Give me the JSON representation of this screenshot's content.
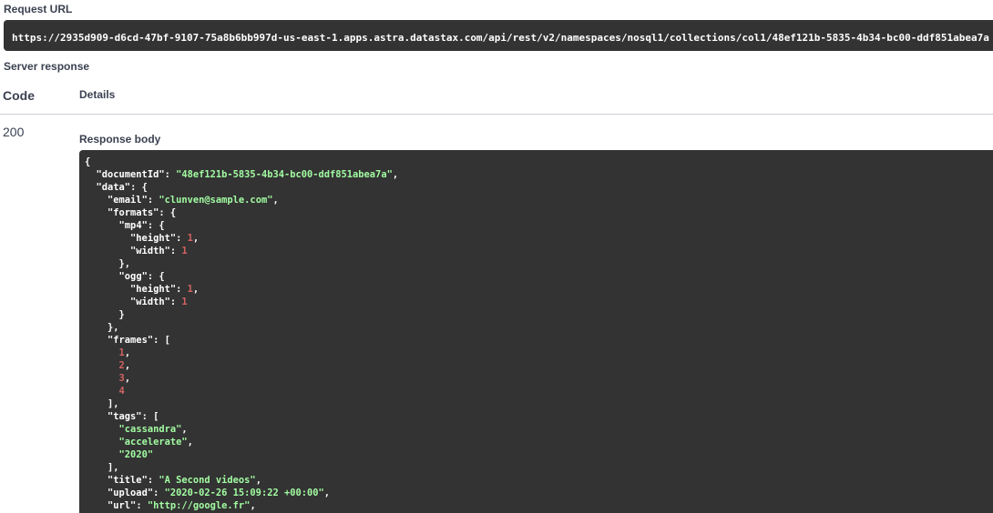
{
  "request_url": {
    "label": "Request URL",
    "value": "https://2935d909-d6cd-47bf-9107-75a8b6bb997d-us-east-1.apps.astra.datastax.com/api/rest/v2/namespaces/nosql1/collections/col1/48ef121b-5835-4b34-bc00-ddf851abea7a"
  },
  "server_response": {
    "label": "Server response",
    "columns": {
      "code": "Code",
      "details": "Details"
    },
    "status_code": "200",
    "body_label": "Response body",
    "body_lines": [
      [
        [
          "p",
          "{"
        ]
      ],
      [
        [
          "p",
          "  "
        ],
        [
          "k",
          "\"documentId\""
        ],
        [
          "p",
          ": "
        ],
        [
          "s",
          "\"48ef121b-5835-4b34-bc00-ddf851abea7a\""
        ],
        [
          "p",
          ","
        ]
      ],
      [
        [
          "p",
          "  "
        ],
        [
          "k",
          "\"data\""
        ],
        [
          "p",
          ": {"
        ]
      ],
      [
        [
          "p",
          "    "
        ],
        [
          "k",
          "\"email\""
        ],
        [
          "p",
          ": "
        ],
        [
          "s",
          "\"clunven@sample.com\""
        ],
        [
          "p",
          ","
        ]
      ],
      [
        [
          "p",
          "    "
        ],
        [
          "k",
          "\"formats\""
        ],
        [
          "p",
          ": {"
        ]
      ],
      [
        [
          "p",
          "      "
        ],
        [
          "k",
          "\"mp4\""
        ],
        [
          "p",
          ": {"
        ]
      ],
      [
        [
          "p",
          "        "
        ],
        [
          "k",
          "\"height\""
        ],
        [
          "p",
          ": "
        ],
        [
          "n",
          "1"
        ],
        [
          "p",
          ","
        ]
      ],
      [
        [
          "p",
          "        "
        ],
        [
          "k",
          "\"width\""
        ],
        [
          "p",
          ": "
        ],
        [
          "n",
          "1"
        ]
      ],
      [
        [
          "p",
          "      },"
        ]
      ],
      [
        [
          "p",
          "      "
        ],
        [
          "k",
          "\"ogg\""
        ],
        [
          "p",
          ": {"
        ]
      ],
      [
        [
          "p",
          "        "
        ],
        [
          "k",
          "\"height\""
        ],
        [
          "p",
          ": "
        ],
        [
          "n",
          "1"
        ],
        [
          "p",
          ","
        ]
      ],
      [
        [
          "p",
          "        "
        ],
        [
          "k",
          "\"width\""
        ],
        [
          "p",
          ": "
        ],
        [
          "n",
          "1"
        ]
      ],
      [
        [
          "p",
          "      }"
        ]
      ],
      [
        [
          "p",
          "    },"
        ]
      ],
      [
        [
          "p",
          "    "
        ],
        [
          "k",
          "\"frames\""
        ],
        [
          "p",
          ": ["
        ]
      ],
      [
        [
          "p",
          "      "
        ],
        [
          "n",
          "1"
        ],
        [
          "p",
          ","
        ]
      ],
      [
        [
          "p",
          "      "
        ],
        [
          "n",
          "2"
        ],
        [
          "p",
          ","
        ]
      ],
      [
        [
          "p",
          "      "
        ],
        [
          "n",
          "3"
        ],
        [
          "p",
          ","
        ]
      ],
      [
        [
          "p",
          "      "
        ],
        [
          "n",
          "4"
        ]
      ],
      [
        [
          "p",
          "    ],"
        ]
      ],
      [
        [
          "p",
          "    "
        ],
        [
          "k",
          "\"tags\""
        ],
        [
          "p",
          ": ["
        ]
      ],
      [
        [
          "p",
          "      "
        ],
        [
          "s",
          "\"cassandra\""
        ],
        [
          "p",
          ","
        ]
      ],
      [
        [
          "p",
          "      "
        ],
        [
          "s",
          "\"accelerate\""
        ],
        [
          "p",
          ","
        ]
      ],
      [
        [
          "p",
          "      "
        ],
        [
          "s",
          "\"2020\""
        ]
      ],
      [
        [
          "p",
          "    ],"
        ]
      ],
      [
        [
          "p",
          "    "
        ],
        [
          "k",
          "\"title\""
        ],
        [
          "p",
          ": "
        ],
        [
          "s",
          "\"A Second videos\""
        ],
        [
          "p",
          ","
        ]
      ],
      [
        [
          "p",
          "    "
        ],
        [
          "k",
          "\"upload\""
        ],
        [
          "p",
          ": "
        ],
        [
          "s",
          "\"2020-02-26 15:09:22 +00:00\""
        ],
        [
          "p",
          ","
        ]
      ],
      [
        [
          "p",
          "    "
        ],
        [
          "k",
          "\"url\""
        ],
        [
          "p",
          ": "
        ],
        [
          "s",
          "\"http://google.fr\""
        ],
        [
          "p",
          ","
        ]
      ]
    ]
  },
  "colors": {
    "code_background": "#333333",
    "string": "#a2fca2",
    "number": "#d36363",
    "text": "#3b4151"
  }
}
